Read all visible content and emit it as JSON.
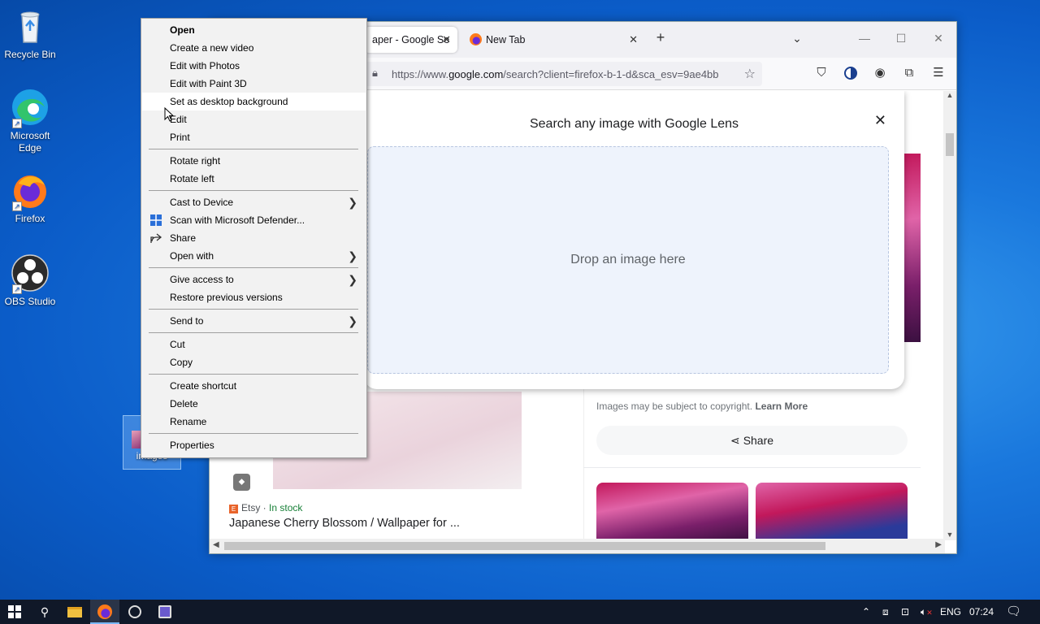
{
  "desktop": {
    "icons": [
      {
        "label": "Recycle Bin"
      },
      {
        "label": "Microsoft Edge"
      },
      {
        "label": "Firefox"
      },
      {
        "label": "OBS Studio"
      },
      {
        "label": "images"
      }
    ]
  },
  "browser": {
    "tabs": [
      {
        "label": "aper - Google Se"
      },
      {
        "label": "New Tab"
      }
    ],
    "url_prefix": "https://www.",
    "url_host": "google.com",
    "url_rest": "/search?client=firefox-b-1-d&sca_esv=9ae4bb",
    "lens": {
      "title": "Search any image with Google Lens",
      "drop_text": "Drop an image here"
    },
    "result": {
      "source": "Etsy",
      "stock": "In stock",
      "title": "Japanese Cherry Blossom / Wallpaper for ...",
      "copyright": "Images may be subject to copyright.",
      "learn_more": "Learn More",
      "share": "Share"
    }
  },
  "context_menu": {
    "items": [
      {
        "label": "Open"
      },
      {
        "label": "Create a new video"
      },
      {
        "label": "Edit with Photos"
      },
      {
        "label": "Edit with Paint 3D"
      },
      {
        "label": "Set as desktop background"
      },
      {
        "label": "Edit"
      },
      {
        "label": "Print"
      },
      {
        "label": "Rotate right"
      },
      {
        "label": "Rotate left"
      },
      {
        "label": "Cast to Device"
      },
      {
        "label": "Scan with Microsoft Defender..."
      },
      {
        "label": "Share"
      },
      {
        "label": "Open with"
      },
      {
        "label": "Give access to"
      },
      {
        "label": "Restore previous versions"
      },
      {
        "label": "Send to"
      },
      {
        "label": "Cut"
      },
      {
        "label": "Copy"
      },
      {
        "label": "Create shortcut"
      },
      {
        "label": "Delete"
      },
      {
        "label": "Rename"
      },
      {
        "label": "Properties"
      }
    ]
  },
  "taskbar": {
    "language": "ENG",
    "time": "07:24"
  },
  "colors": {
    "accent": "#0b5cc8",
    "taskbar": "#101828",
    "menu_bg": "#f2f2f2"
  }
}
